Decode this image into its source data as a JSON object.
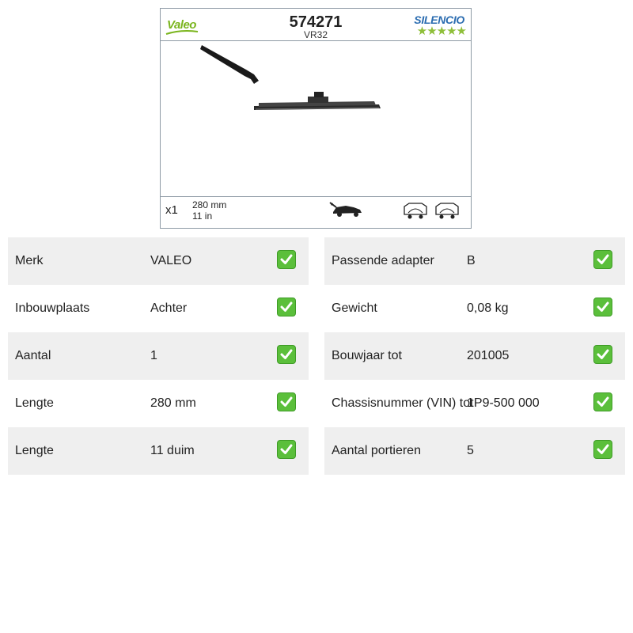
{
  "product": {
    "brand_logo": "Valeo",
    "part_number": "574271",
    "part_code": "VR32",
    "series_logo": "SILENCIO",
    "rating_stars": "★★★★★",
    "quantity": "x1",
    "length_mm": "280 mm",
    "length_in": "11 in",
    "icons": [
      "wiper-arm-blade-icon",
      "rear-hatch-car-icon",
      "rear-window-wiper-left-icon",
      "rear-window-wiper-right-icon"
    ]
  },
  "specs_left": [
    {
      "label": "Merk",
      "value": "VALEO",
      "check": "checkmark-icon"
    },
    {
      "label": "Inbouwplaats",
      "value": "Achter",
      "check": "checkmark-icon"
    },
    {
      "label": "Aantal",
      "value": "1",
      "check": "checkmark-icon"
    },
    {
      "label": "Lengte",
      "value": "280 mm",
      "check": "checkmark-icon"
    },
    {
      "label": "Lengte",
      "value": "11 duim",
      "check": "checkmark-icon"
    }
  ],
  "specs_right": [
    {
      "label": "Passende adapter",
      "value": "B",
      "check": "checkmark-icon"
    },
    {
      "label": "Gewicht",
      "value": "0,08 kg",
      "check": "checkmark-icon"
    },
    {
      "label": "Bouwjaar tot",
      "value": "201005",
      "check": "checkmark-icon"
    },
    {
      "label": "Chassisnummer (VIN) tot",
      "value": "1P9-500 000",
      "check": "checkmark-icon"
    },
    {
      "label": "Aantal portieren",
      "value": "5",
      "check": "checkmark-icon"
    }
  ],
  "colors": {
    "row_shade": "#efefef",
    "check_green": "#5bbf3b",
    "valeo_green": "#7ab51d",
    "silencio_blue": "#2a6cb0"
  }
}
